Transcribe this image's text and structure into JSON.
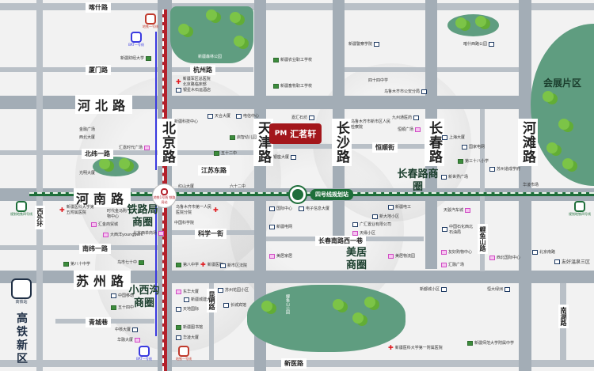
{
  "roads": {
    "kashi": "喀什路",
    "xiamen": "厦门路",
    "hangzhou": "杭州路",
    "hebei": "河北路",
    "beiwei1": "北纬一路",
    "jiangsudong": "江苏东路",
    "henan": "河南路",
    "kexue1": "科学一街",
    "nanwei1": "南纬一路",
    "suzhou": "苏州路",
    "qingcheng": "青城巷",
    "xinyi": "新医路",
    "beijing": "北京路",
    "tianjin": "天津路",
    "changsha": "长沙路",
    "changchun": "长春路",
    "hetan": "河滩路",
    "xiwaihuan": "西外环",
    "kunming": "昆明路",
    "liyushan": "鲤鱼山路",
    "nanhu": "南湖路",
    "hengshun": "恒顺街",
    "changchunnan": "长春南路西一巷"
  },
  "zones": {
    "tielu": "铁路局商圈",
    "xiaoxigou": "小西沟商圈",
    "changchunlu": "长春路商圈",
    "meiju": "美居商圈",
    "huizhan": "会展片区",
    "gaotie": "高铁新区"
  },
  "project": {
    "name": "汇茗轩",
    "logo_text": "PM"
  },
  "metro": {
    "line4": "四号线规划站",
    "line1_north": "地铁一号线",
    "brt": "BRT一号线",
    "beijing_station": "地铁1号线 铁路局站",
    "line1_south": "地铁一号线",
    "brt_south": "BRT一号线",
    "west_station": "规划地铁四号线",
    "east_station": "规划地铁四号线",
    "gaotie_station": "高铁站"
  },
  "pois": [
    "新疆财经大学",
    "新疆军区总医院 北京路临床部",
    "银星木石运酒店",
    "新疆农业职工学校",
    "新疆畜牧职工学校",
    "新疆警察学院",
    "喀什西路公园",
    "四十四中学",
    "乌鲁木齐市公安分局",
    "九州通医药",
    "恒顺广场",
    "乌鲁木齐市新市区人民检察院",
    "上海大厦",
    "国家电网",
    "第三十八小学",
    "新世界广场",
    "华凌市场",
    "苏州道成学府",
    "天合大厦",
    "电信中心",
    "启智幼儿园",
    "五十二中",
    "汇嘉时代广场",
    "新疆科技中心",
    "银座大厦",
    "六十二中",
    "红山大厦",
    "嘉汇石坊",
    "金融广场",
    "西北大厦",
    "光明大厦",
    "中国科学院",
    "乌鲁木齐市第一人民医院分院",
    "新疆医科大学第五附属医院",
    "时代金马购物中心",
    "汇金商贸城",
    "大西洋youngpark",
    "北京西单商场",
    "第八十中学",
    "乌市七十中",
    "第八中学",
    "新疆医院",
    "新市区法院",
    "东华大厦",
    "中国移动",
    "五十四中",
    "中核大厦",
    "新疆城建大厦",
    "华融大厦",
    "天地国际",
    "新疆图书馆",
    "华凌大厦",
    "苏州花园小区",
    "长城宾馆",
    "电子信息大厦",
    "新疆电网",
    "国际中心",
    "美居物流园",
    "美居家居",
    "新疆电工",
    "新大地小区",
    "广汇置业有限公司",
    "天缘小区",
    "天骏汽车城",
    "中国石化西北石油局",
    "友好购物中心",
    "汇融广场",
    "西北国际中心",
    "友好温泉三区",
    "新疆医科大学第一附属医院",
    "新疆师范大学附属中学",
    "新都城小区",
    "恒大绿洲",
    "北京南路",
    "鲤鱼山公园",
    "新疆森林公园"
  ]
}
